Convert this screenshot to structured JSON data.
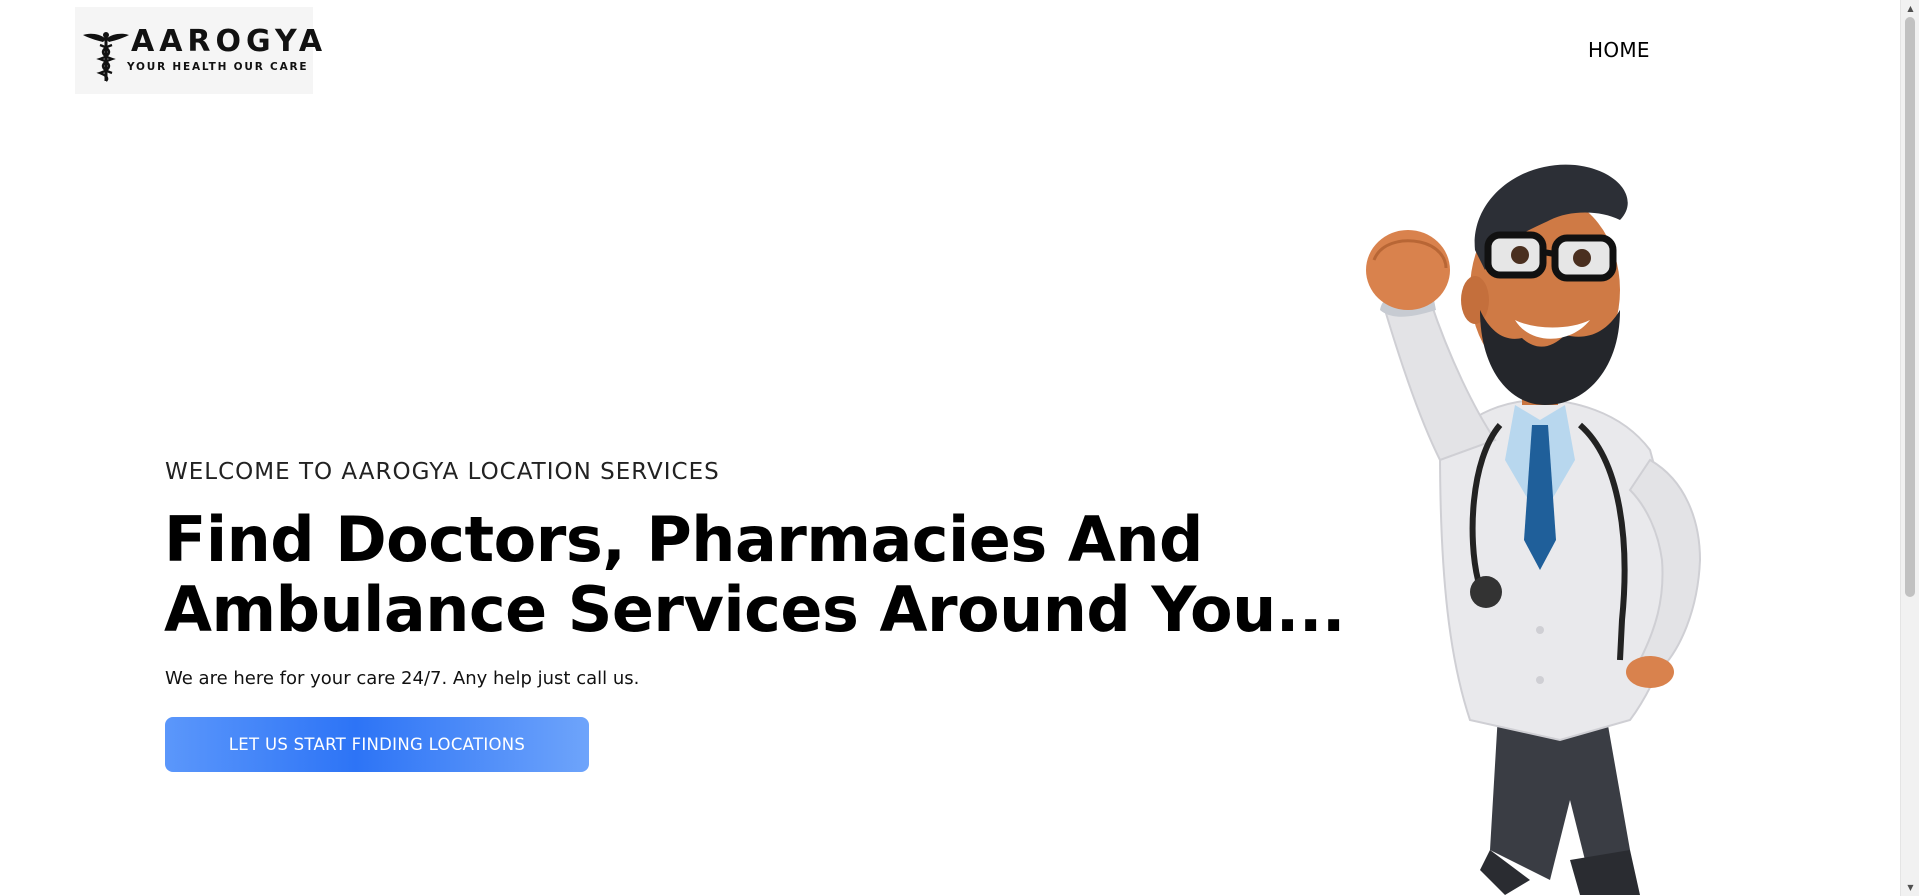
{
  "brand": {
    "name": "AAROGYA",
    "tagline": "YOUR HEALTH OUR CARE",
    "logo_icon": "caduceus-icon"
  },
  "nav": {
    "items": [
      {
        "label": "HOME"
      }
    ]
  },
  "hero": {
    "eyebrow": "WELCOME TO AAROGYA LOCATION SERVICES",
    "headline_line1": "Find Doctors, Pharmacies And",
    "headline_line2": "Ambulance Services Around You...",
    "subtext": "We are here for your care 24/7. Any help just call us.",
    "cta_label": "LET US START FINDING LOCATIONS",
    "illustration": "cartoon-doctor-flying-illustration"
  },
  "colors": {
    "cta_gradient_start": "#5b97fb",
    "cta_gradient_mid": "#2d74f6",
    "cta_text": "#ffffff",
    "text_primary": "#000000",
    "background": "#ffffff"
  }
}
